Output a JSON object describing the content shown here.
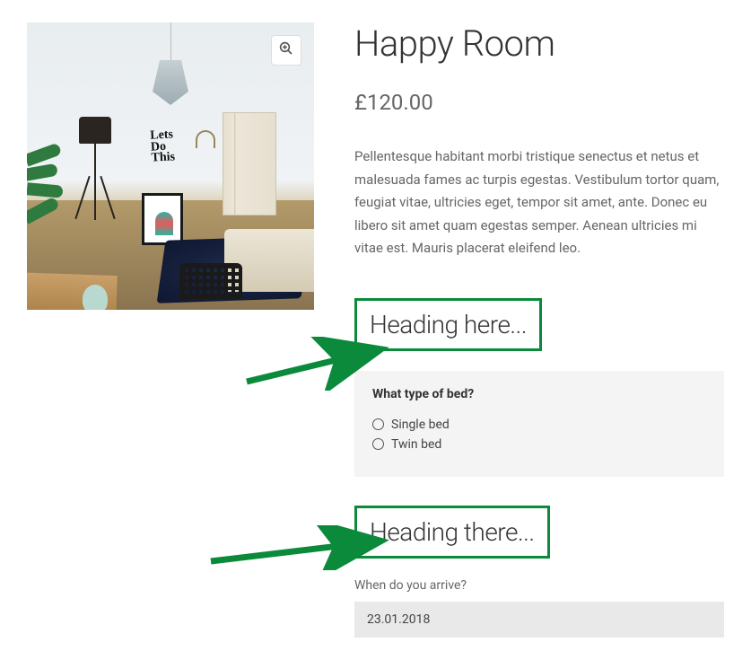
{
  "product": {
    "title": "Happy Room",
    "price": "£120.00",
    "description": "Pellentesque habitant morbi tristique senectus et netus et malesuada fames ac turpis egestas. Vestibulum tortor quam, feugiat vitae, ultricies eget, tempor sit amet, ante. Donec eu libero sit amet quam egestas semper. Aenean ultricies mi vitae est. Mauris placerat eleifend leo.",
    "image_wall_text": "Lets\nDo\nThis"
  },
  "sections": {
    "heading1": "Heading here...",
    "heading2": "Heading there..."
  },
  "bed_type": {
    "label": "What type of bed?",
    "options": [
      "Single bed",
      "Twin bed"
    ]
  },
  "arrival": {
    "label": "When do you arrive?",
    "value": "23.01.2018"
  },
  "annotation": {
    "highlight_color": "#0a8a3a"
  }
}
